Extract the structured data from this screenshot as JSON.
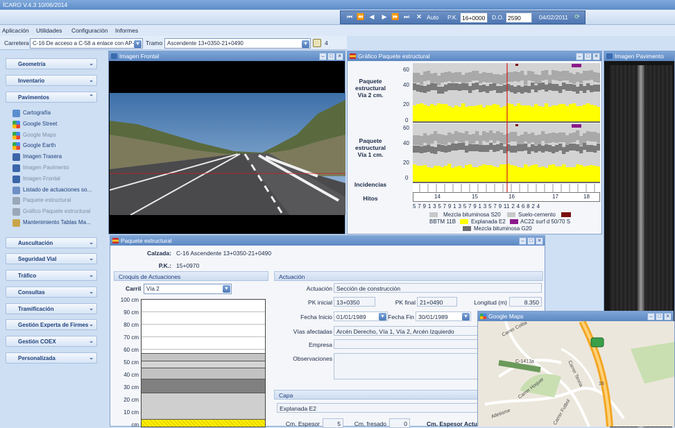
{
  "app": {
    "title": "ÍCARO V.4.3 10/06/2014"
  },
  "nav": {
    "auto": "Auto",
    "pk_label": "P.K.",
    "pk_value": "16+0000",
    "do_label": "D.O.",
    "do_value": "2590",
    "date": "04/02/2011"
  },
  "menu": [
    "Aplicación",
    "Utilidades",
    "Configuración",
    "Informes"
  ],
  "road": {
    "carretera_label": "Carretera",
    "carretera_value": "C-16 De acceso a C-58 a enlace con AP-7",
    "tramo_label": "Tramo",
    "tramo_value": "Ascendente 13+0350-21+0490",
    "count": "4"
  },
  "sidebar": {
    "groups_top": [
      "Geometría",
      "Inventario",
      "Pavimentos"
    ],
    "items": [
      {
        "label": "Cartografía",
        "enabled": true,
        "icon": "map-icon"
      },
      {
        "label": "Google Street",
        "enabled": true,
        "icon": "google-icon"
      },
      {
        "label": "Google Maps",
        "enabled": false,
        "icon": "google-icon"
      },
      {
        "label": "Google Earth",
        "enabled": true,
        "icon": "google-icon"
      },
      {
        "label": "Imagen Trasera",
        "enabled": true,
        "icon": "camera-icon"
      },
      {
        "label": "Imagen Pavimento",
        "enabled": false,
        "icon": "camera-icon"
      },
      {
        "label": "Imagen Frontal",
        "enabled": false,
        "icon": "camera-icon"
      },
      {
        "label": "Listado de actuaciones so...",
        "enabled": true,
        "icon": "table-icon"
      },
      {
        "label": "Paquete estructural",
        "enabled": false,
        "icon": "document-icon"
      },
      {
        "label": "Gráfico Paquete estructural",
        "enabled": false,
        "icon": "chart-icon"
      },
      {
        "label": "Mantenimiento Tablas Ma...",
        "enabled": true,
        "icon": "tag-icon"
      }
    ],
    "groups_bottom": [
      "Auscultación",
      "Seguridad Vial",
      "Tráfico",
      "Consultas",
      "Tramificación",
      "Gestión Experta de Firmes",
      "Gestión COEX",
      "Personalizada"
    ]
  },
  "windows": {
    "frontal": {
      "title": "Imagen Frontal"
    },
    "grafico": {
      "title": "Gráfico Paquete estructural",
      "row_labels": {
        "via2": "Paquete estructural Vía 2 cm.",
        "via1": "Paquete estructural Vía 1 cm.",
        "incidencias": "Incidencias",
        "hitos": "Hitos"
      },
      "axis_ticks": [
        "60",
        "40",
        "20",
        "0"
      ],
      "hitos": [
        "14",
        "15",
        "16",
        "17",
        "18"
      ],
      "bottom_digits": "5 7 9 1 3 5 7 9 1 3 5 7 9 1 3 5 7 9 11 2 4 6 8 2 4",
      "legend": [
        {
          "label": "Mezcla bituminosa S20",
          "color": "#c8c8c8"
        },
        {
          "label": "Suelo-cemento",
          "color": "#7b0d0d"
        },
        {
          "label": "BBTM 11B",
          "color": "#a8a8a8"
        },
        {
          "label": "Explanada E2",
          "color": "#ffff00"
        },
        {
          "label": "AC22 surf d 50/70 S",
          "color": "#8b1a8b"
        },
        {
          "label": "Mezcla bituminosa G20",
          "color": "#6e6e6e"
        }
      ]
    },
    "pavimento": {
      "title": "Imagen Pavimento"
    },
    "paquete": {
      "title": "Paquete estructural",
      "calzada_label": "Calzada:",
      "calzada_value": "C-16 Ascendente 13+0350-21+0490",
      "pk_label": "P.K.:",
      "pk_value": "15+0970",
      "croquis_title": "Croquis de Actuaciones",
      "carril_label": "Carril",
      "carril_value": "Vía 2",
      "y_ticks": [
        "100 cm",
        "90 cm",
        "80 cm",
        "70 cm",
        "60 cm",
        "50 cm",
        "40 cm",
        "30 cm",
        "20 cm",
        "10 cm",
        "cm"
      ],
      "actuacion": {
        "title": "Actuación",
        "actuacion_label": "Actuación",
        "actuacion_value": "Sección de construcción",
        "pk_inicial_label": "PK inicial",
        "pk_inicial_value": "13+0350",
        "pk_final_label": "PK final",
        "pk_final_value": "21+0490",
        "longitud_label": "Longitud (m)",
        "longitud_value": "8.350",
        "fecha_inicio_label": "Fecha Inicio",
        "fecha_inicio_value": "01/01/1989",
        "fecha_fin_label": "Fecha Fin",
        "fecha_fin_value": "30/01/1989",
        "vias_label": "Vías afectadas",
        "vias_value": "Arcén Derecho, Vía 1, Vía 2, Arcén Izquierdo",
        "empresa_label": "Empresa",
        "observaciones_label": "Observaciones"
      },
      "capa": {
        "title": "Capa",
        "value": "Explanada E2",
        "espesor_label": "Cm. Espesor",
        "espesor_value": "5",
        "fresado_label": "Cm. fresado",
        "fresado_value": "0",
        "actual_label": "Cm. Espesor Actual"
      }
    },
    "maps": {
      "title": "Google Maps",
      "streets": [
        "Carrer Colita",
        "C-1413a",
        "Carrer Tenria",
        "Carrer Hoquer",
        "Carrer Futbol",
        "Atletisme",
        "16"
      ]
    }
  }
}
